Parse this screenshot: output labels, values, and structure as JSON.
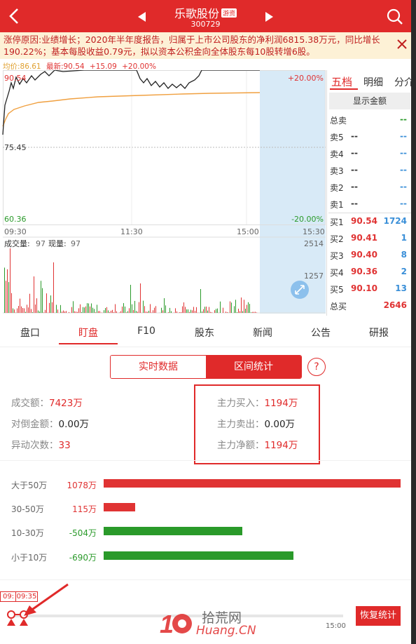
{
  "header": {
    "title": "乐歌股份",
    "badge": "游资",
    "code": "300729"
  },
  "notice": {
    "text": "涨停原因:业绩增长；2020年半年度报告，归属于上市公司股东的净利润6815.38万元，同比增长190.22%；基本每股收益0.79元，拟以资本公积金向全体股东每10股转增6股。"
  },
  "chart_info": {
    "avg_label": "均价:",
    "avg_value": "86.61",
    "latest_label": "最新:",
    "latest_value": "90.54",
    "change": "+15.09",
    "change_pct": "+20.00%"
  },
  "price_chart": {
    "y_high": "90.54",
    "y_mid": "75.45",
    "y_low": "60.36",
    "pct_high": "+20.00%",
    "pct_low": "-20.00%",
    "t1": "09:30",
    "t2": "11:30",
    "t3": "15:00",
    "t4": "15:30"
  },
  "volume_chart": {
    "label1": "成交量:",
    "value1": "97",
    "label2": "现量:",
    "value2": "97",
    "y_max": "2514",
    "y_mid": "1257"
  },
  "orderbook": {
    "tabs": [
      "五档",
      "明细",
      "分介"
    ],
    "show_amount": "显示金额",
    "total_sell_label": "总卖",
    "total_sell_value": "--",
    "sells": [
      {
        "label": "卖5",
        "price": "--",
        "vol": "--"
      },
      {
        "label": "卖4",
        "price": "--",
        "vol": "--"
      },
      {
        "label": "卖3",
        "price": "--",
        "vol": "--"
      },
      {
        "label": "卖2",
        "price": "--",
        "vol": "--"
      },
      {
        "label": "卖1",
        "price": "--",
        "vol": "--"
      }
    ],
    "buys": [
      {
        "label": "买1",
        "price": "90.54",
        "vol": "1724"
      },
      {
        "label": "买2",
        "price": "90.41",
        "vol": "1"
      },
      {
        "label": "买3",
        "price": "90.40",
        "vol": "8"
      },
      {
        "label": "买4",
        "price": "90.36",
        "vol": "2"
      },
      {
        "label": "买5",
        "price": "90.10",
        "vol": "13"
      }
    ],
    "total_buy_label": "总买",
    "total_buy_value": "2646"
  },
  "tabs": [
    "盘口",
    "盯盘",
    "F10",
    "股东",
    "新闻",
    "公告",
    "研报"
  ],
  "segment": {
    "left": "实时数据",
    "right": "区间统计",
    "help": "?"
  },
  "stats": {
    "turnover_label": "成交额：",
    "turnover_value": "7423万",
    "hedge_label": "对倒金额：",
    "hedge_value": "0.00万",
    "abnormal_label": "异动次数：",
    "abnormal_value": "33",
    "main_buy_label": "主力买入：",
    "main_buy_value": "1194万",
    "main_sell_label": "主力卖出：",
    "main_sell_value": "0.00万",
    "main_net_label": "主力净额：",
    "main_net_value": "1194万"
  },
  "fund_flow": [
    {
      "label": "大于50万",
      "value": "1078万",
      "amount": 1078,
      "color": "#e03333"
    },
    {
      "label": "30-50万",
      "value": "115万",
      "amount": 115,
      "color": "#e03333"
    },
    {
      "label": "10-30万",
      "value": "-504万",
      "amount": -504,
      "color": "#2a9a2a"
    },
    {
      "label": "小于10万",
      "value": "-690万",
      "amount": -690,
      "color": "#2a9a2a"
    }
  ],
  "timeline": {
    "start_box": "09:",
    "start_time": "09:35",
    "end_time": "15:00",
    "restore_button": "恢复统计"
  },
  "watermark": {
    "cn": "拾荒网",
    "en": "Huang.CN"
  },
  "colors": {
    "brand_red": "#e02a2a",
    "up": "#e03333",
    "down": "#2a9a2a",
    "price_line": "#222222",
    "avg_line": "#f0a040"
  }
}
